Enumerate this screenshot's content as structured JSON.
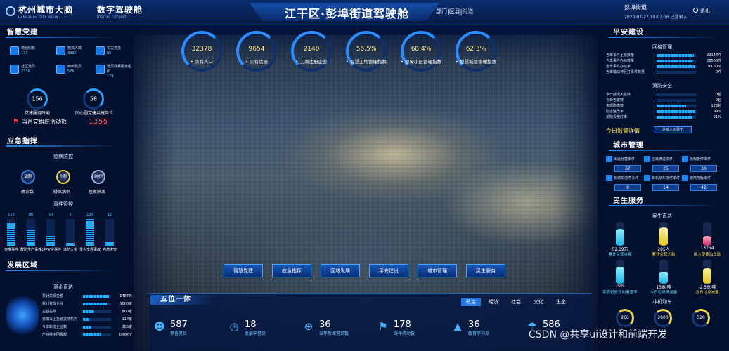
{
  "header": {
    "logo_title": "杭州城市大脑",
    "logo_sub": "HANGZHOU CITY BRAIN",
    "logo2_title": "数字驾驶舱",
    "logo2_sub": "DIGITAL COCKPIT",
    "title": "江干区·彭埠街道驾驶舱",
    "crumb": "部门|区县|街道",
    "user": "彭埠街道",
    "time": "2020-07-27 10:07:16",
    "login": "已登录入",
    "exit": "退出"
  },
  "left": {
    "party": {
      "title": "智慧党建",
      "items": [
        {
          "label": "党组织数",
          "value": "173"
        },
        {
          "label": "党员人数",
          "value": "3390"
        },
        {
          "label": "机关党员",
          "value": "86"
        },
        {
          "label": "社区党员",
          "value": "2736"
        },
        {
          "label": "两新党员",
          "value": "576"
        },
        {
          "label": "党员联系服务组织",
          "value": "179"
        }
      ],
      "rings": [
        {
          "value": "156",
          "label": "党建服务阵地"
        },
        {
          "value": "58",
          "label": "同心圆党建共建单位"
        }
      ],
      "activity_label": "当月党组织活动数",
      "activity_value": "1355"
    },
    "emergency": {
      "title": "应急指挥",
      "epidemic_title": "疫病防控",
      "circles": [
        {
          "value": "2例",
          "label": "确诊数"
        },
        {
          "value": "0例",
          "label": "疑似病例"
        },
        {
          "value": "18例",
          "label": "居家隔离"
        }
      ],
      "events_title": "事件管控",
      "bars": [
        {
          "value": "118",
          "label": "突发事件",
          "pct": 0.87
        },
        {
          "value": "86",
          "label": "群防生产事件",
          "pct": 0.64
        },
        {
          "value": "50",
          "label": "公共安全事件",
          "pct": 0.37
        },
        {
          "value": "5",
          "label": "滚防火灾",
          "pct": 0.1
        },
        {
          "value": "135",
          "label": "重大交通事故",
          "pct": 1.0
        },
        {
          "value": "12",
          "label": "自然灾害",
          "pct": 0.16
        }
      ]
    },
    "develop": {
      "title": "发展区域",
      "sub": "惠企直达",
      "rows": [
        {
          "label": "累计兑现金额",
          "value": "5487万",
          "pct": 0.92
        },
        {
          "label": "累计兑现企业",
          "value": "5000家",
          "pct": 0.85
        },
        {
          "label": "企业总数",
          "value": "800家",
          "pct": 0.4
        },
        {
          "label": "省级以上金融扶持机构",
          "value": "114家",
          "pct": 0.22
        },
        {
          "label": "今年新增企业数",
          "value": "305家",
          "pct": 0.3
        },
        {
          "label": "产业楼宇回报额",
          "value": "850km²",
          "pct": 0.65
        }
      ]
    }
  },
  "gauges": [
    {
      "value": "32378",
      "label": "实有人口"
    },
    {
      "value": "9654",
      "label": "实有房屋"
    },
    {
      "value": "2140",
      "label": "工商注册企业"
    },
    {
      "value": "56.5%",
      "label": "智慧工地管理指数"
    },
    {
      "value": "68.4%",
      "label": "智安小区管理指数"
    },
    {
      "value": "62.3%",
      "label": "智慧城管管理指数"
    }
  ],
  "nav": [
    "智慧党建",
    "应急指挥",
    "区域发展",
    "平安建设",
    "城市管理",
    "民生服务"
  ],
  "five": {
    "title": "五位一体",
    "tabs": [
      "政治",
      "经济",
      "社会",
      "文化",
      "生态"
    ],
    "active_tab": "政治",
    "stats": [
      {
        "value": "587",
        "label": "预备党员"
      },
      {
        "value": "18",
        "label": "发展中党员"
      },
      {
        "value": "36",
        "label": "当年新增党员数"
      },
      {
        "value": "178",
        "label": "当年活动数"
      },
      {
        "value": "36",
        "label": "教育学习点"
      },
      {
        "value": "586",
        "label": ""
      }
    ]
  },
  "right": {
    "safety": {
      "title": "平安建设",
      "grid_title": "网格管理",
      "grid_rows": [
        {
          "label": "当年事件上报数量",
          "value": "29144件",
          "pct": 0.95
        },
        {
          "label": "当年事件办结数量",
          "value": "28566件",
          "pct": 0.92
        },
        {
          "label": "当年事件办结率",
          "value": "99.60%",
          "pct": 0.99
        },
        {
          "label": "当年输动神经打事件数量",
          "value": "0件",
          "pct": 0.02
        }
      ],
      "fire_title": "消防安全",
      "fire_rows": [
        {
          "label": "今日成灾火警数",
          "value": "0起",
          "pct": 0.02
        },
        {
          "label": "今日告警数",
          "value": "0起",
          "pct": 0.02
        },
        {
          "label": "实现隐患数",
          "value": "128起",
          "pct": 0.75
        },
        {
          "label": "隐患整改率",
          "value": "99%",
          "pct": 0.99
        },
        {
          "label": "消防设施好率",
          "value": "91%",
          "pct": 0.91
        }
      ],
      "alarm_label": "今日报警详情",
      "alarm_button": "进城入火警干"
    },
    "city": {
      "title": "城市管理",
      "tiles": [
        {
          "label": "出运经营事件",
          "value": "67"
        },
        {
          "label": "垃圾满溢事件",
          "value": "25"
        },
        {
          "label": "违规管停事件",
          "value": "36"
        },
        {
          "label": "机动车违停事件",
          "value": "9"
        },
        {
          "label": "非机动车违停事件",
          "value": "14"
        },
        {
          "label": "游商摊贩事件",
          "value": "42"
        }
      ]
    },
    "live": {
      "title": "民生服务",
      "sub": "民生直达",
      "cyls": [
        {
          "value": "52.69万",
          "label": "累计兑现金额",
          "level": 0.7,
          "color": "c"
        },
        {
          "value": "285人",
          "label": "累计兑现人数",
          "level": 0.75,
          "color": "y"
        },
        {
          "value": "13254",
          "label": "接入便捷泊车数",
          "level": 0.4,
          "color": "p"
        },
        {
          "value": "70%",
          "label": "家庭好医贡约覆盖率",
          "level": 0.7,
          "color": "c"
        },
        {
          "value": "1580吨",
          "label": "今日垃圾清运量",
          "level": 0.5,
          "color": "c"
        },
        {
          "value": "-2.560吨",
          "label": "当日垃圾减量",
          "level": 0.65,
          "color": "y"
        }
      ],
      "car_title": "非机动车",
      "car_rings": [
        "260",
        "2800",
        "520"
      ]
    }
  },
  "watermark": "CSDN @共享ui设计和前端开发"
}
